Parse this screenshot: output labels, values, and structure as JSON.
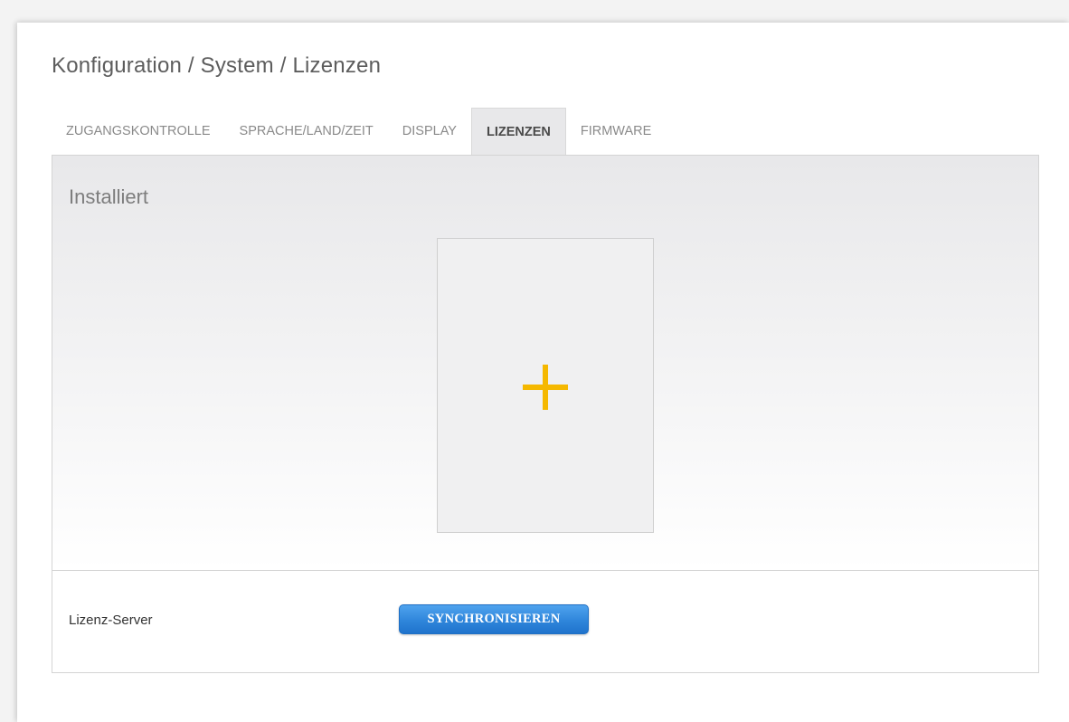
{
  "breadcrumb": {
    "title": "Konfiguration / System / Lizenzen"
  },
  "tabs": [
    {
      "label": "ZUGANGSKONTROLLE",
      "active": false
    },
    {
      "label": "SPRACHE/LAND/ZEIT",
      "active": false
    },
    {
      "label": "DISPLAY",
      "active": false
    },
    {
      "label": "LIZENZEN",
      "active": true
    },
    {
      "label": "FIRMWARE",
      "active": false
    }
  ],
  "installed": {
    "heading": "Installiert",
    "add_icon": "plus-icon",
    "accent_color": "#f5b800"
  },
  "license_server": {
    "label": "Lizenz-Server",
    "button_label": "SYNCHRONISIEREN",
    "button_color": "#2f86db"
  }
}
